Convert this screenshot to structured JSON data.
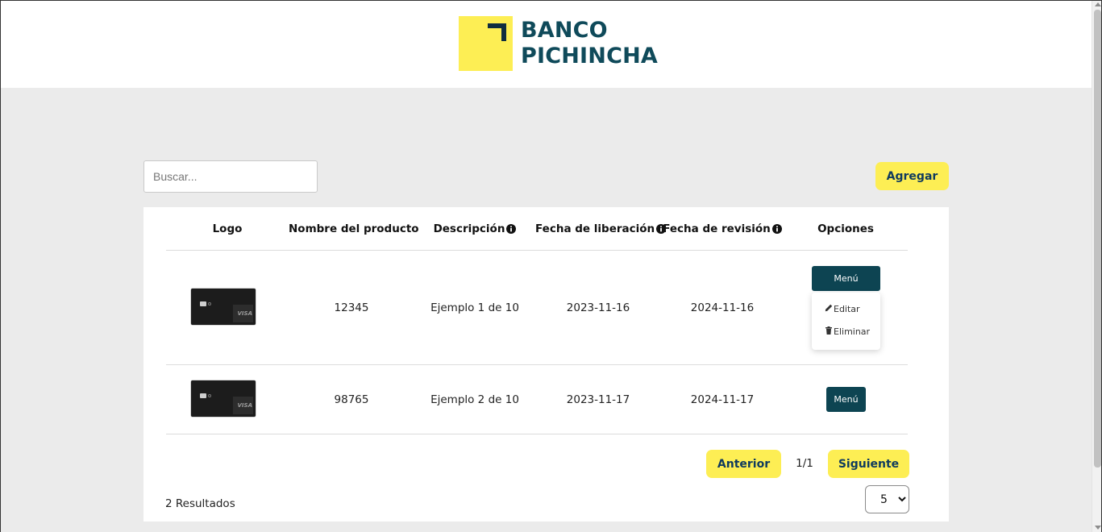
{
  "brand": {
    "line1": "BANCO",
    "line2": "PICHINCHA",
    "colors": {
      "yellow": "#fdee54",
      "dark_teal": "#0d4452",
      "text_blue": "#0f3a5e"
    }
  },
  "toolbar": {
    "search_placeholder": "Buscar...",
    "add_label": "Agregar"
  },
  "table": {
    "headers": {
      "logo": "Logo",
      "name": "Nombre del producto",
      "description": "Descripción",
      "release": "Fecha de liberación",
      "revision": "Fecha de revisión",
      "options": "Opciones"
    },
    "header_info_icon": "info-circle-icon",
    "rows": [
      {
        "logo_icon": "visa-card-image",
        "name": "12345",
        "description": "Ejemplo 1 de 10",
        "release": "2023-11-16",
        "revision": "2024-11-16",
        "menu_label": "Menú"
      },
      {
        "logo_icon": "visa-card-image",
        "name": "98765",
        "description": "Ejemplo 2 de 10",
        "release": "2023-11-17",
        "revision": "2024-11-17",
        "menu_label": "Menú"
      }
    ],
    "card_brand": "VISA"
  },
  "dropdown": {
    "open_for_row": 0,
    "items": [
      {
        "label": "Editar",
        "icon": "pencil-icon"
      },
      {
        "label": "Eliminar",
        "icon": "trash-icon"
      }
    ]
  },
  "pagination": {
    "prev_label": "Anterior",
    "next_label": "Siguiente",
    "page_indicator": "1/1",
    "results_text": "2 Resultados",
    "page_size_selected": "5"
  }
}
